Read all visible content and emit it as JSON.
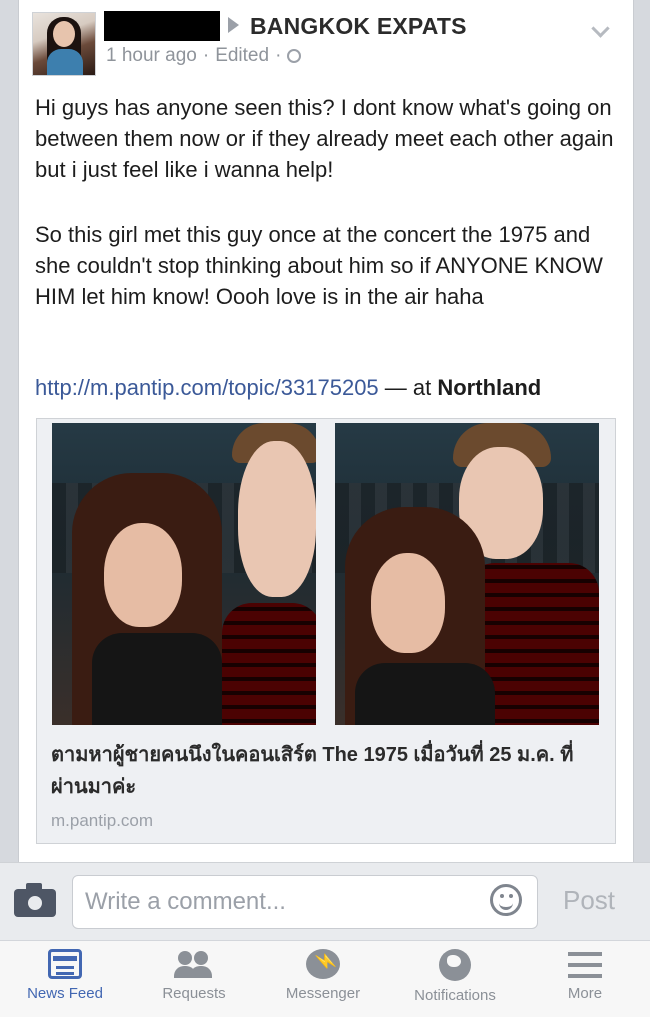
{
  "post": {
    "group": "BANGKOK EXPATS",
    "time": "1 hour ago",
    "edited": "Edited",
    "separator": "·",
    "paragraph1": "Hi guys has anyone seen this? I dont know what's going on between them now or if they already meet each other again but i just feel like i wanna help!",
    "paragraph2": "So this girl met this guy once at the concert the 1975 and she couldn't stop thinking about him so if ANYONE KNOW HIM let him know! Oooh love is in the air haha",
    "url": "http://m.pantip.com/topic/33175205",
    "at": " — at ",
    "place": "Northland"
  },
  "share": {
    "title": "ตามหาผู้ชายคนนึงในคอนเสิร์ต The 1975 เมื่อวันที่ 25 ม.ค. ที่ผ่านมาค่ะ",
    "domain": "m.pantip.com"
  },
  "comment": {
    "placeholder": "Write a comment...",
    "post_label": "Post"
  },
  "tabs": [
    {
      "label": "News Feed",
      "icon": "newsfeed-icon"
    },
    {
      "label": "Requests",
      "icon": "requests-icon"
    },
    {
      "label": "Messenger",
      "icon": "messenger-icon"
    },
    {
      "label": "Notifications",
      "icon": "globe-icon"
    },
    {
      "label": "More",
      "icon": "menu-icon"
    }
  ],
  "colors": {
    "link": "#3b5998",
    "active_tab": "#4267b2"
  }
}
